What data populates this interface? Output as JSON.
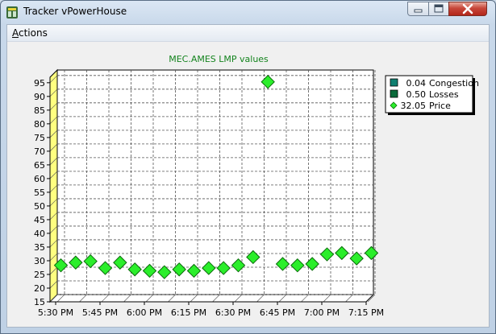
{
  "window": {
    "title": "Tracker vPowerHouse"
  },
  "menu": {
    "actions_label": "Actions"
  },
  "colors": {
    "price_fill": "#2bee2b",
    "price_stroke": "#0a6a0a",
    "title_color": "#14841e",
    "wall": "#ffff80",
    "congestion": "#0f7f70",
    "losses": "#0b6a3a"
  },
  "icons": {
    "app": "tracker-app-icon",
    "minimize": "minimize-icon",
    "maximize": "maximize-icon",
    "close": "close-icon"
  },
  "legend": {
    "entries": [
      {
        "value": "0.04",
        "label": "Congestion"
      },
      {
        "value": "0.50",
        "label": "Losses"
      },
      {
        "value": "32.05",
        "label": "Price"
      }
    ]
  },
  "chart_data": {
    "type": "scatter",
    "title": "MEC.AMES LMP values",
    "xlabel": "",
    "ylabel": "",
    "ylim": [
      15,
      97
    ],
    "yticks": [
      15,
      20,
      25,
      30,
      35,
      40,
      45,
      50,
      55,
      60,
      65,
      70,
      75,
      80,
      85,
      90,
      95
    ],
    "xticks": [
      "5:30 PM",
      "5:45 PM",
      "6:00 PM",
      "6:15 PM",
      "6:30 PM",
      "6:45 PM",
      "7:00 PM",
      "7:15 PM"
    ],
    "grid": true,
    "legend_position": "top-right",
    "series": [
      {
        "name": "Price",
        "x": [
          "5:30 PM",
          "5:35 PM",
          "5:40 PM",
          "5:45 PM",
          "5:50 PM",
          "5:55 PM",
          "6:00 PM",
          "6:05 PM",
          "6:10 PM",
          "6:15 PM",
          "6:20 PM",
          "6:25 PM",
          "6:30 PM",
          "6:35 PM",
          "6:40 PM",
          "6:45 PM",
          "6:50 PM",
          "6:55 PM",
          "7:00 PM",
          "7:05 PM",
          "7:10 PM",
          "7:15 PM"
        ],
        "y": [
          27,
          28,
          28.5,
          26,
          28,
          25.5,
          25,
          24.5,
          25.5,
          25,
          26,
          26,
          27,
          30,
          94,
          27.5,
          27,
          27.5,
          31,
          31.5,
          29.5,
          31.5
        ]
      }
    ]
  }
}
